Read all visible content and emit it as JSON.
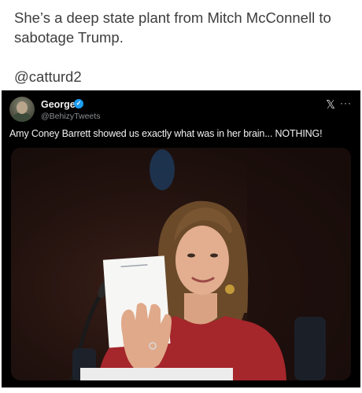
{
  "post": {
    "line1": "She’s a deep state plant from Mitch McConnell to",
    "line2": "sabotage Trump.",
    "mention": "@catturd2"
  },
  "embedded_tweet": {
    "author_name": "George",
    "verified_mark": "✓",
    "author_handle": "@BehizyTweets",
    "x_logo": "𝕏",
    "more": "···",
    "text": "Amy Coney Barrett showed us exactly what was in her brain... NOTHING!",
    "photo": {
      "subject": "woman with shoulder-length hair in red sweater holding a blank white notepad beside her face",
      "notepad_header": "Senate Judiciary"
    }
  },
  "colors": {
    "post_text": "#3d3d3d",
    "embed_bg": "#000000",
    "verified": "#1d9bf0",
    "sweater": "#a5262b"
  }
}
